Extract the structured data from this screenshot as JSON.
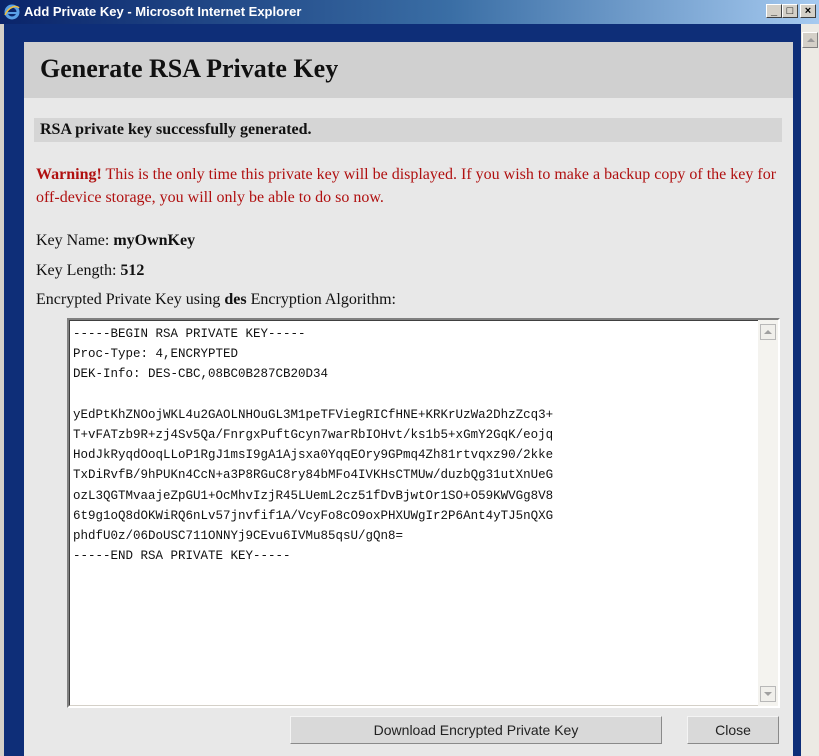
{
  "window": {
    "title": "Add Private Key - Microsoft Internet Explorer",
    "controls": {
      "minimize": "_",
      "maximize": "□",
      "close": "×"
    }
  },
  "page": {
    "heading": "Generate RSA Private Key",
    "success_message": "RSA private key successfully generated.",
    "warning_prefix": "Warning!",
    "warning_text": " This is the only time this private key will be displayed. If you wish to make a backup copy of the key for off-device storage, you will only be able to do so now.",
    "key_name_label": "Key Name: ",
    "key_name_value": "myOwnKey",
    "key_length_label": "Key Length: ",
    "key_length_value": "512",
    "encrypted_label_prefix": "Encrypted Private Key using ",
    "encrypted_algorithm": "des",
    "encrypted_label_suffix": " Encryption Algorithm:",
    "key_text": "-----BEGIN RSA PRIVATE KEY-----\nProc-Type: 4,ENCRYPTED\nDEK-Info: DES-CBC,08BC0B287CB20D34\n\nyEdPtKhZNOojWKL4u2GAOLNHOuGL3M1peTFViegRICfHNE+KRKrUzWa2DhzZcq3+\nT+vFATzb9R+zj4Sv5Qa/FnrgxPuftGcyn7warRbIOHvt/ks1b5+xGmY2GqK/eojq\nHodJkRyqdOoqLLoP1RgJ1msI9gA1Ajsxa0YqqEOry9GPmq4Zh81rtvqxz90/2kke\nTxDiRvfB/9hPUKn4CcN+a3P8RGuC8ry84bMFo4IVKHsCTMUw/duzbQg31utXnUeG\nozL3QGTMvaajeZpGU1+OcMhvIzjR45LUemL2cz51fDvBjwtOr1SO+O59KWVGg8V8\n6t9g1oQ8dOKWiRQ6nLv57jnvfif1A/VcyFo8cO9oxPHXUWgIr2P6Ant4yTJ5nQXG\nphdfU0z/06DoUSC711ONNYj9CEvu6IVMu85qsU/gQn8=\n-----END RSA PRIVATE KEY-----",
    "download_button": "Download Encrypted Private Key",
    "close_button": "Close"
  },
  "colors": {
    "titlebar_start": "#0a246a",
    "viewport_background": "#0e2e78",
    "warning": "#b01010"
  }
}
